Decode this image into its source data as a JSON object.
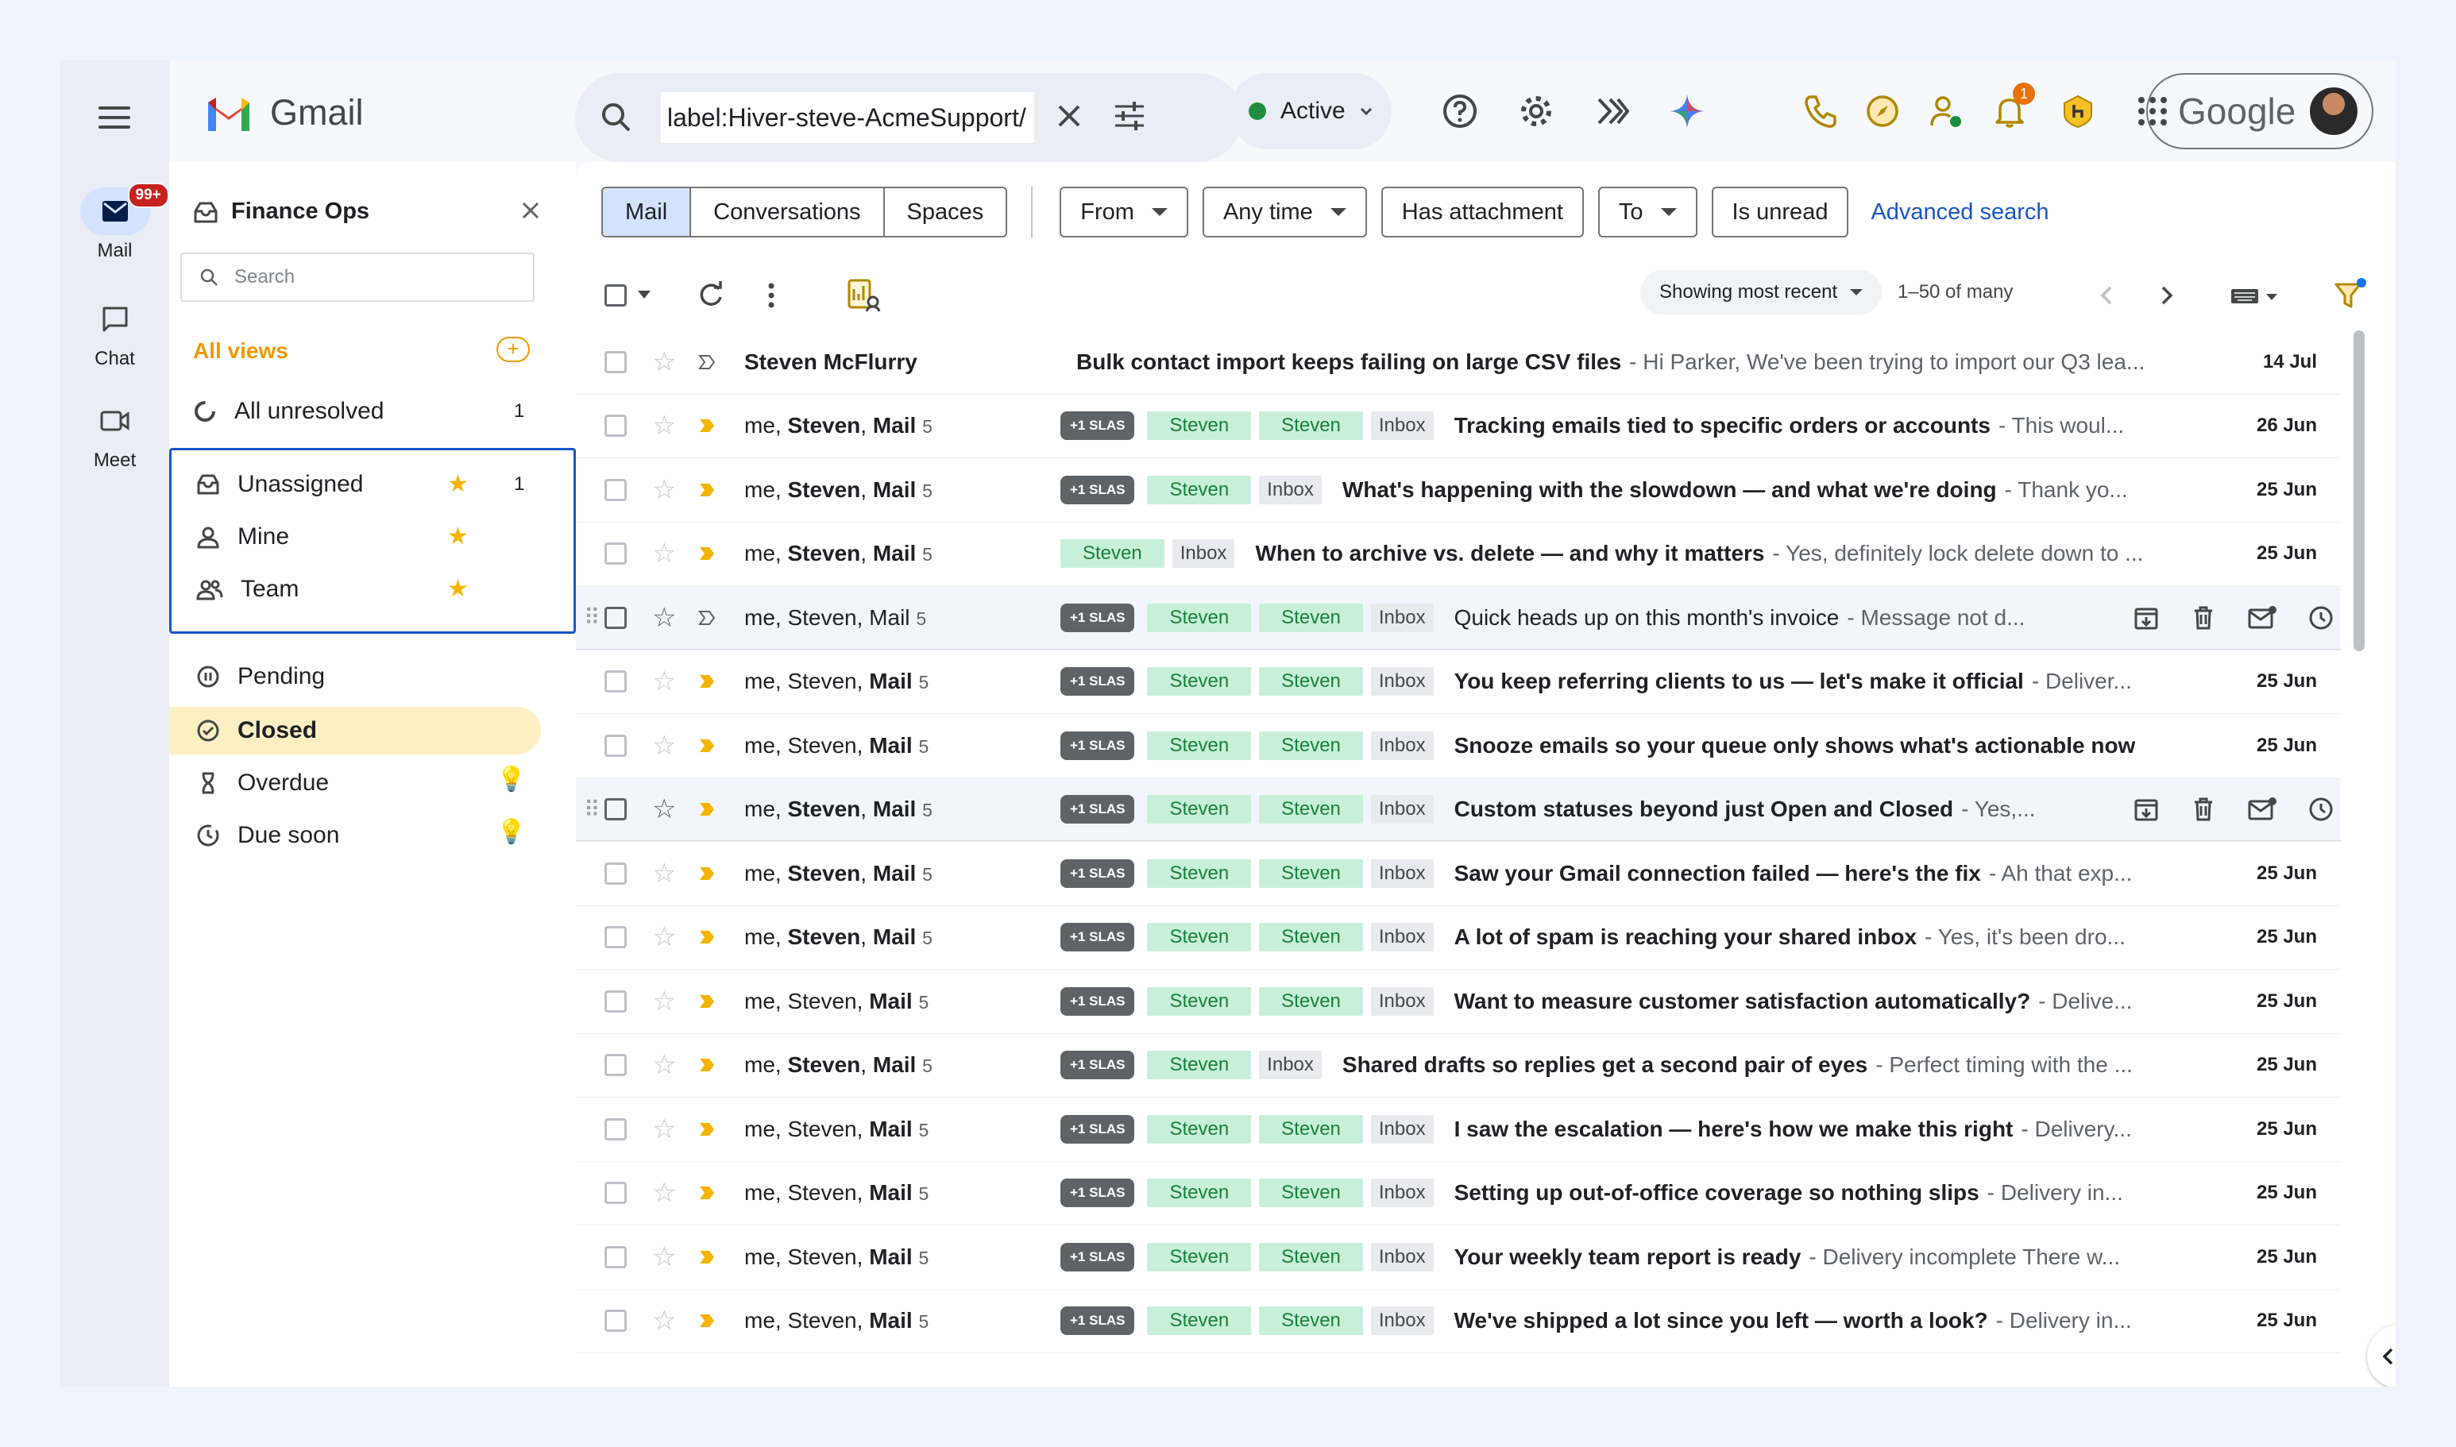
{
  "rail": {
    "items": [
      {
        "label": "Mail",
        "badge": "99+"
      },
      {
        "label": "Chat"
      },
      {
        "label": "Meet"
      }
    ]
  },
  "header": {
    "app_name": "Gmail",
    "search_value": "label:Hiver-steve-AcmeSupport/",
    "status": "Active",
    "notification_count": "1",
    "account_brand": "Google"
  },
  "panel": {
    "title": "Finance Ops",
    "search_placeholder": "Search",
    "all_views": "All views",
    "all_views_add": "+",
    "all_unresolved": {
      "label": "All unresolved",
      "count": "1"
    },
    "views": [
      {
        "label": "Unassigned",
        "count": "1"
      },
      {
        "label": "Mine"
      },
      {
        "label": "Team"
      }
    ],
    "status_views": [
      {
        "label": "Pending"
      },
      {
        "label": "Closed"
      },
      {
        "label": "Overdue"
      },
      {
        "label": "Due soon"
      }
    ]
  },
  "filters": {
    "segments": [
      "Mail",
      "Conversations",
      "Spaces"
    ],
    "chips": [
      "From",
      "Any time",
      "Has attachment",
      "To",
      "Is unread"
    ],
    "advanced": "Advanced search"
  },
  "toolbar": {
    "sort": "Showing most recent",
    "page": "1–50 of many"
  },
  "emails": [
    {
      "sender": "Steven McFlurry",
      "sender_bold": true,
      "count": "",
      "tags": [],
      "subject": "Bulk contact import keeps failing on large CSV files",
      "snippet": "- Hi Parker, We've been trying to import our Q3 lea...",
      "date": "14 Jul",
      "important": false
    },
    {
      "sender_pre": "me, ",
      "sender_b1": "Steven",
      "sender_mid": ", ",
      "sender_b2": "Mail",
      "count": "5",
      "tags": [
        "+1 SLAS",
        "Steven",
        "Steven",
        "Inbox"
      ],
      "subject": "Tracking emails tied to specific orders or accounts",
      "snippet": "- This woul...",
      "date": "26 Jun",
      "important": true
    },
    {
      "sender_pre": "me, ",
      "sender_b1": "Steven",
      "sender_mid": ", ",
      "sender_b2": "Mail",
      "count": "5",
      "tags": [
        "+1 SLAS",
        "Steven",
        "Inbox"
      ],
      "subject": "What's happening with the slowdown — and what we're doing",
      "snippet": "- Thank yo...",
      "date": "25 Jun",
      "important": true
    },
    {
      "sender_pre": "me, ",
      "sender_b1": "Steven",
      "sender_mid": ", ",
      "sender_b2": "Mail",
      "count": "5",
      "tags": [
        "Steven",
        "Inbox"
      ],
      "subject": "When to archive vs. delete — and why it matters",
      "snippet": "- Yes, definitely lock delete down to ...",
      "date": "25 Jun",
      "important": true
    },
    {
      "sender_pre": "me, Steven, Mail",
      "count": "5",
      "tags": [
        "+1 SLAS",
        "Steven",
        "Steven",
        "Inbox"
      ],
      "subject": "Quick heads up on this month's invoice",
      "snippet": "- Message not d...",
      "date": "",
      "important": false,
      "hover": true,
      "subject_plain": true
    },
    {
      "sender_pre": "me, Steven, ",
      "sender_b2": "Mail",
      "count": "5",
      "tags": [
        "+1 SLAS",
        "Steven",
        "Steven",
        "Inbox"
      ],
      "subject": "You keep referring clients to us — let's make it official",
      "snippet": "- Deliver...",
      "date": "25 Jun",
      "important": true
    },
    {
      "sender_pre": "me, Steven, ",
      "sender_b2": "Mail",
      "count": "5",
      "tags": [
        "+1 SLAS",
        "Steven",
        "Steven",
        "Inbox"
      ],
      "subject": "Snooze emails so your queue only shows what's actionable now",
      "snippet": "",
      "date": "25 Jun",
      "important": true
    },
    {
      "sender_pre": "me, ",
      "sender_b1": "Steven",
      "sender_mid": ", ",
      "sender_b2": "Mail",
      "count": "5",
      "tags": [
        "+1 SLAS",
        "Steven",
        "Steven",
        "Inbox"
      ],
      "subject": "Custom statuses beyond just Open and Closed",
      "snippet": "- Yes,...",
      "date": "",
      "important": true,
      "hover": true
    },
    {
      "sender_pre": "me, ",
      "sender_b1": "Steven",
      "sender_mid": ", ",
      "sender_b2": "Mail",
      "count": "5",
      "tags": [
        "+1 SLAS",
        "Steven",
        "Steven",
        "Inbox"
      ],
      "subject": "Saw your Gmail connection failed — here's the fix",
      "snippet": "- Ah that exp...",
      "date": "25 Jun",
      "important": true
    },
    {
      "sender_pre": "me, ",
      "sender_b1": "Steven",
      "sender_mid": ", ",
      "sender_b2": "Mail",
      "count": "5",
      "tags": [
        "+1 SLAS",
        "Steven",
        "Steven",
        "Inbox"
      ],
      "subject": "A lot of spam is reaching your shared inbox",
      "snippet": "- Yes, it's been dro...",
      "date": "25 Jun",
      "important": true
    },
    {
      "sender_pre": "me, Steven, ",
      "sender_b2": "Mail",
      "count": "5",
      "tags": [
        "+1 SLAS",
        "Steven",
        "Steven",
        "Inbox"
      ],
      "subject": "Want to measure customer satisfaction automatically?",
      "snippet": "- Delive...",
      "date": "25 Jun",
      "important": true
    },
    {
      "sender_pre": "me, ",
      "sender_b1": "Steven",
      "sender_mid": ", ",
      "sender_b2": "Mail",
      "count": "5",
      "tags": [
        "+1 SLAS",
        "Steven",
        "Inbox"
      ],
      "subject": "Shared drafts so replies get a second pair of eyes",
      "snippet": "- Perfect timing with the ...",
      "date": "25 Jun",
      "important": true
    },
    {
      "sender_pre": "me, Steven, ",
      "sender_b2": "Mail",
      "count": "5",
      "tags": [
        "+1 SLAS",
        "Steven",
        "Steven",
        "Inbox"
      ],
      "subject": "I saw the escalation — here's how we make this right",
      "snippet": "- Delivery...",
      "date": "25 Jun",
      "important": true
    },
    {
      "sender_pre": "me, Steven, ",
      "sender_b2": "Mail",
      "count": "5",
      "tags": [
        "+1 SLAS",
        "Steven",
        "Steven",
        "Inbox"
      ],
      "subject": "Setting up out-of-office coverage so nothing slips",
      "snippet": "- Delivery in...",
      "date": "25 Jun",
      "important": true
    },
    {
      "sender_pre": "me, Steven, ",
      "sender_b2": "Mail",
      "count": "5",
      "tags": [
        "+1 SLAS",
        "Steven",
        "Steven",
        "Inbox"
      ],
      "subject": "Your weekly team report is ready",
      "snippet": "- Delivery incomplete There w...",
      "date": "25 Jun",
      "important": true
    },
    {
      "sender_pre": "me, Steven, ",
      "sender_b2": "Mail",
      "count": "5",
      "tags": [
        "+1 SLAS",
        "Steven",
        "Steven",
        "Inbox"
      ],
      "subject": "We've shipped a lot since you left — worth a look?",
      "snippet": "- Delivery in...",
      "date": "25 Jun",
      "important": true
    }
  ],
  "colors": {
    "accent": "#1a56c7",
    "sla_tag": "#5f6368",
    "label_green": "#c8f0d9",
    "all_views": "#f29900",
    "closed_highlight": "#feefc3"
  }
}
